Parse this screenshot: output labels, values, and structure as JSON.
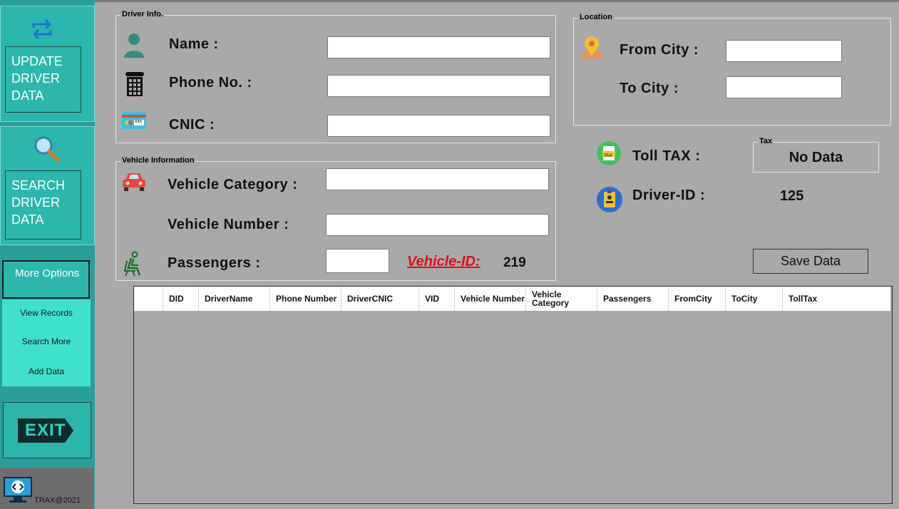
{
  "sidebar": {
    "update_label": "UPDATE DRIVER DATA",
    "search_label": "SEARCH DRIVER DATA",
    "more_options_label": "More Options",
    "options": [
      "View Records",
      "Search More",
      "Add Data"
    ],
    "exit_label": "EXIT",
    "footer_text": "TRAX@2021"
  },
  "driver_info": {
    "title": "Driver Info.",
    "name_label": "Name :",
    "name_value": "",
    "phone_label": "Phone No. :",
    "phone_value": "",
    "cnic_label": "CNIC :",
    "cnic_value": "",
    "card_icon_text": "XXX"
  },
  "vehicle_info": {
    "title": "Vehicle Information",
    "category_label": "Vehicle Category :",
    "category_value": "",
    "number_label": "Vehicle Number :",
    "number_value": "",
    "passengers_label": "Passengers :",
    "passengers_value": "",
    "vehicle_id_label": "Vehicle-ID:",
    "vehicle_id_value": "219"
  },
  "location": {
    "title": "Location",
    "from_label": "From City :",
    "from_value": "",
    "to_label": "To City :",
    "to_value": ""
  },
  "tax": {
    "toll_label": "Toll TAX :",
    "group_title": "Tax",
    "value": "No Data",
    "icon_text": "TAX"
  },
  "driver_id": {
    "label": "Driver-ID :",
    "value": "125"
  },
  "save_button": "Save Data",
  "grid": {
    "columns": [
      "DID",
      "DriverName",
      "Phone Number",
      "DriverCNIC",
      "VID",
      "Vehicle Number",
      "Vehicle Category",
      "Passengers",
      "FromCity",
      "ToCity",
      "TollTax"
    ],
    "rows": []
  },
  "colors": {
    "sidebar": "#2bb6ae",
    "options_panel": "#40e0d0",
    "background": "#a9a9a9",
    "vehicle_id_red": "#e0101a"
  }
}
